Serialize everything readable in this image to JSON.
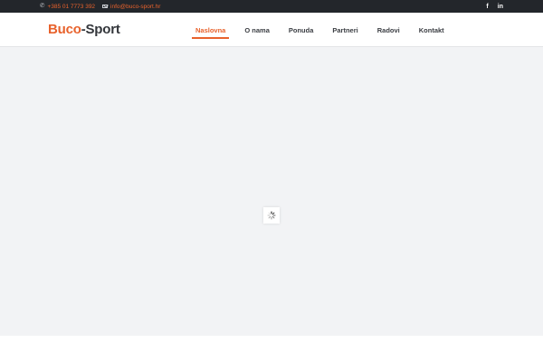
{
  "topbar": {
    "phone": "+385 01 7773 392",
    "email": "info@buco-sport.hr",
    "social": [
      {
        "icon": "facebook-icon",
        "label": "f"
      },
      {
        "icon": "linkedin-icon",
        "label": "in"
      }
    ]
  },
  "logo": {
    "part1": "Buco",
    "part2": "-Sport"
  },
  "nav": {
    "items": [
      {
        "label": "Naslovna",
        "active": true
      },
      {
        "label": "O nama"
      },
      {
        "label": "Ponuda"
      },
      {
        "label": "Partneri"
      },
      {
        "label": "Radovi"
      },
      {
        "label": "Kontakt"
      }
    ]
  },
  "colors": {
    "accent": "#e8622c",
    "topbar": "#23262b",
    "content_bg": "#f2f3f5"
  }
}
